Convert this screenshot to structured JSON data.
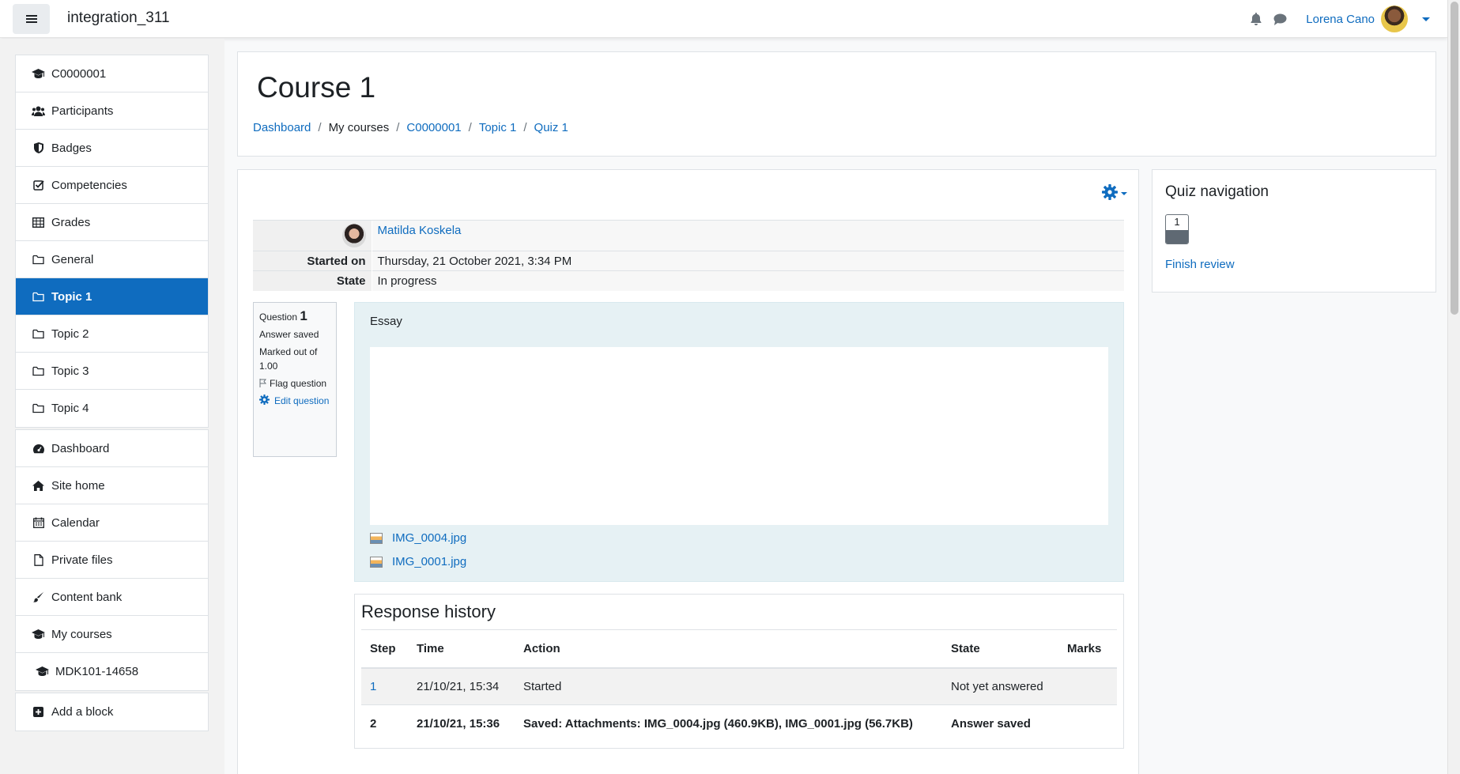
{
  "navbar": {
    "site_name": "integration_311",
    "user_name": "Lorena Cano"
  },
  "drawer": {
    "course_items": [
      {
        "label": "C0000001",
        "icon": "mortarboard-icon"
      },
      {
        "label": "Participants",
        "icon": "users-icon"
      },
      {
        "label": "Badges",
        "icon": "shield-icon"
      },
      {
        "label": "Competencies",
        "icon": "checkbox-icon"
      },
      {
        "label": "Grades",
        "icon": "table-icon"
      },
      {
        "label": "General",
        "icon": "folder-icon"
      },
      {
        "label": "Topic 1",
        "icon": "folder-icon",
        "active": true
      },
      {
        "label": "Topic 2",
        "icon": "folder-icon"
      },
      {
        "label": "Topic 3",
        "icon": "folder-icon"
      },
      {
        "label": "Topic 4",
        "icon": "folder-icon"
      }
    ],
    "site_items": [
      {
        "label": "Dashboard",
        "icon": "dashboard-icon"
      },
      {
        "label": "Site home",
        "icon": "home-icon"
      },
      {
        "label": "Calendar",
        "icon": "calendar-icon"
      },
      {
        "label": "Private files",
        "icon": "file-icon"
      },
      {
        "label": "Content bank",
        "icon": "brush-icon"
      },
      {
        "label": "My courses",
        "icon": "mortarboard-icon"
      },
      {
        "label": "MDK101-14658",
        "icon": "mortarboard-icon"
      }
    ],
    "add_block": "Add a block"
  },
  "header": {
    "title": "Course 1",
    "breadcrumb": [
      "Dashboard",
      "My courses",
      "C0000001",
      "Topic 1",
      "Quiz 1"
    ]
  },
  "summary": {
    "student": "Matilda Koskela",
    "started_on_label": "Started on",
    "started_on": "Thursday, 21 October 2021, 3:34 PM",
    "state_label": "State",
    "state": "In progress"
  },
  "question_info": {
    "question_label": "Question",
    "number": "1",
    "status": "Answer saved",
    "marked_out_of": "Marked out of 1.00",
    "flag": "Flag question",
    "edit": "Edit question"
  },
  "question": {
    "type": "Essay",
    "attachments": [
      "IMG_0004.jpg",
      "IMG_0001.jpg"
    ]
  },
  "history": {
    "title": "Response history",
    "columns": [
      "Step",
      "Time",
      "Action",
      "State",
      "Marks"
    ],
    "rows": [
      {
        "step": "1",
        "time": "21/10/21, 15:34",
        "action": "Started",
        "state": "Not yet answered",
        "marks": ""
      },
      {
        "step": "2",
        "time": "21/10/21, 15:36",
        "action": "Saved: Attachments: IMG_0004.jpg (460.9KB), IMG_0001.jpg (56.7KB)",
        "state": "Answer saved",
        "marks": ""
      }
    ]
  },
  "quiz_nav": {
    "title": "Quiz navigation",
    "button": "1",
    "finish": "Finish review"
  },
  "colors": {
    "accent": "#0f6cbf",
    "question_bg": "#e6f1f4"
  }
}
